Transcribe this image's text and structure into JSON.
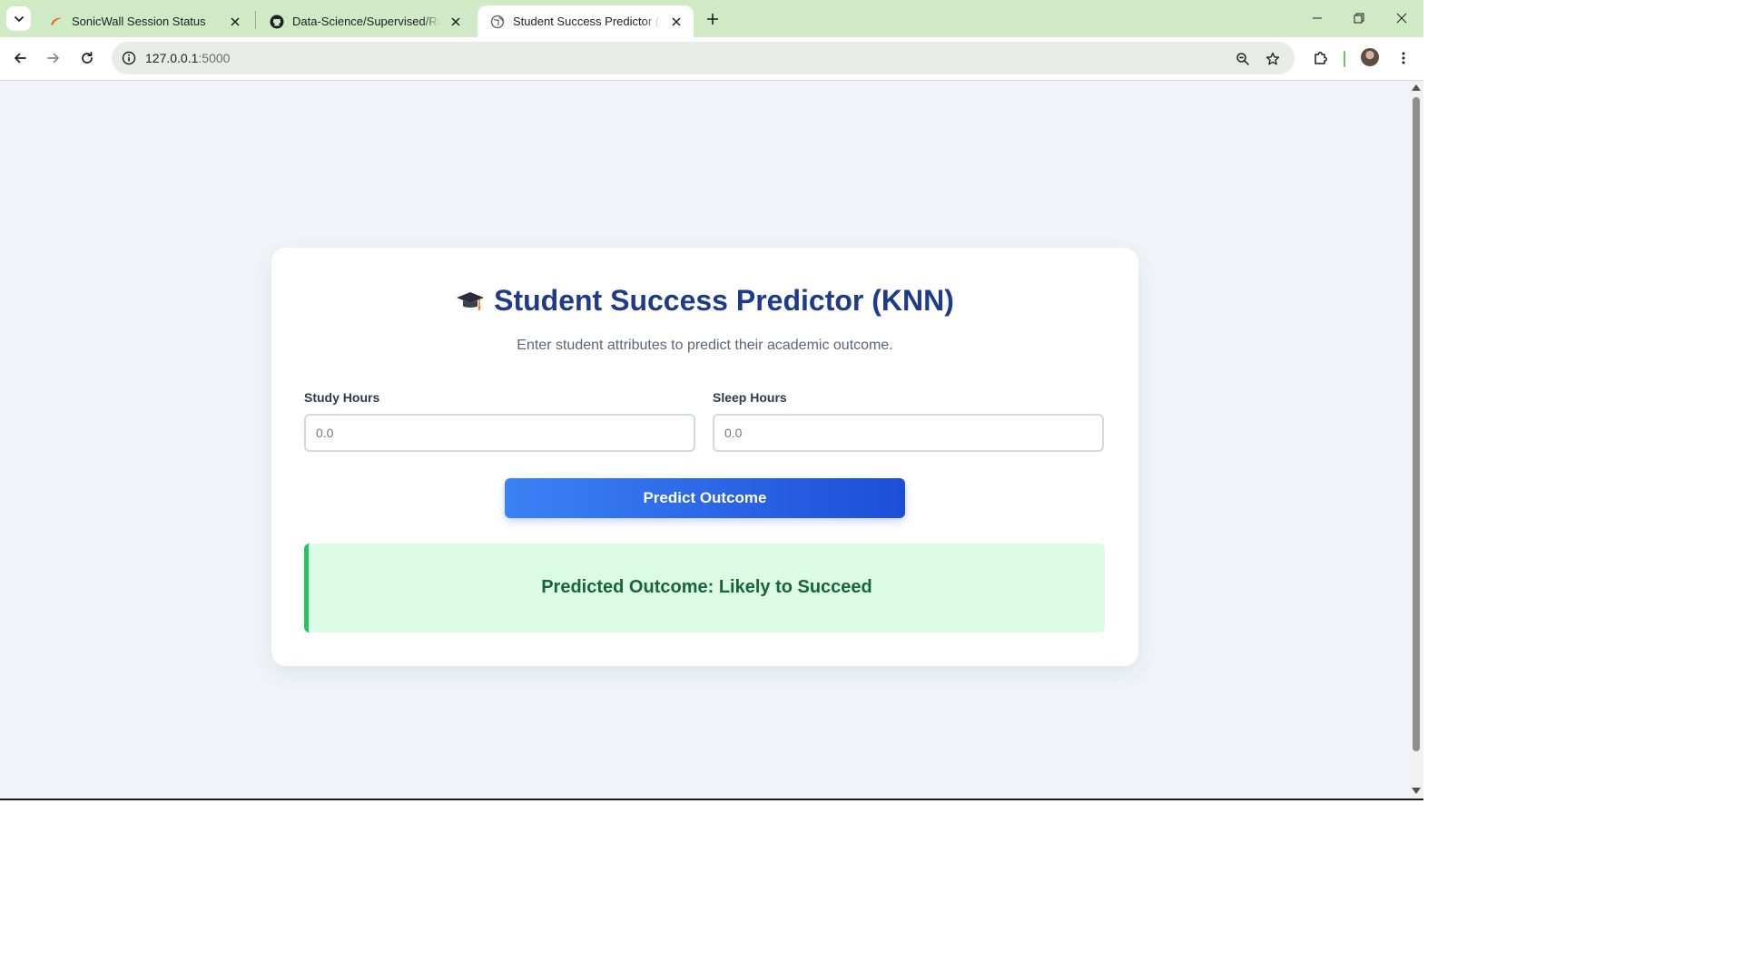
{
  "browser": {
    "tabs": [
      {
        "title": "SonicWall Session Status",
        "favicon": "sonicwall-swoosh-icon"
      },
      {
        "title": "Data-Science/Supervised/Rand",
        "favicon": "github-icon"
      },
      {
        "title": "Student Success Predictor (KNN",
        "favicon": "globe-icon"
      }
    ],
    "active_tab_index": 2,
    "address": {
      "host": "127.0.0.1",
      "port": ":5000"
    }
  },
  "page": {
    "title": "Student Success Predictor (KNN)",
    "title_icon": "graduation-cap-icon",
    "subtitle": "Enter student attributes to predict their academic outcome.",
    "fields": [
      {
        "label": "Study Hours",
        "placeholder": "0.0",
        "value": ""
      },
      {
        "label": "Sleep Hours",
        "placeholder": "0.0",
        "value": ""
      }
    ],
    "predict_button_label": "Predict Outcome",
    "result_text": "Predicted Outcome: Likely to Succeed"
  },
  "colors": {
    "tabstrip_bg": "#cfeac4",
    "page_bg": "#f0f4f8",
    "title_color": "#1e3a8a",
    "button_gradient": [
      "#3b82f6",
      "#1d4ed8"
    ],
    "result_bg": "#dcfce7",
    "result_accent": "#22c55e",
    "result_text": "#166534"
  }
}
